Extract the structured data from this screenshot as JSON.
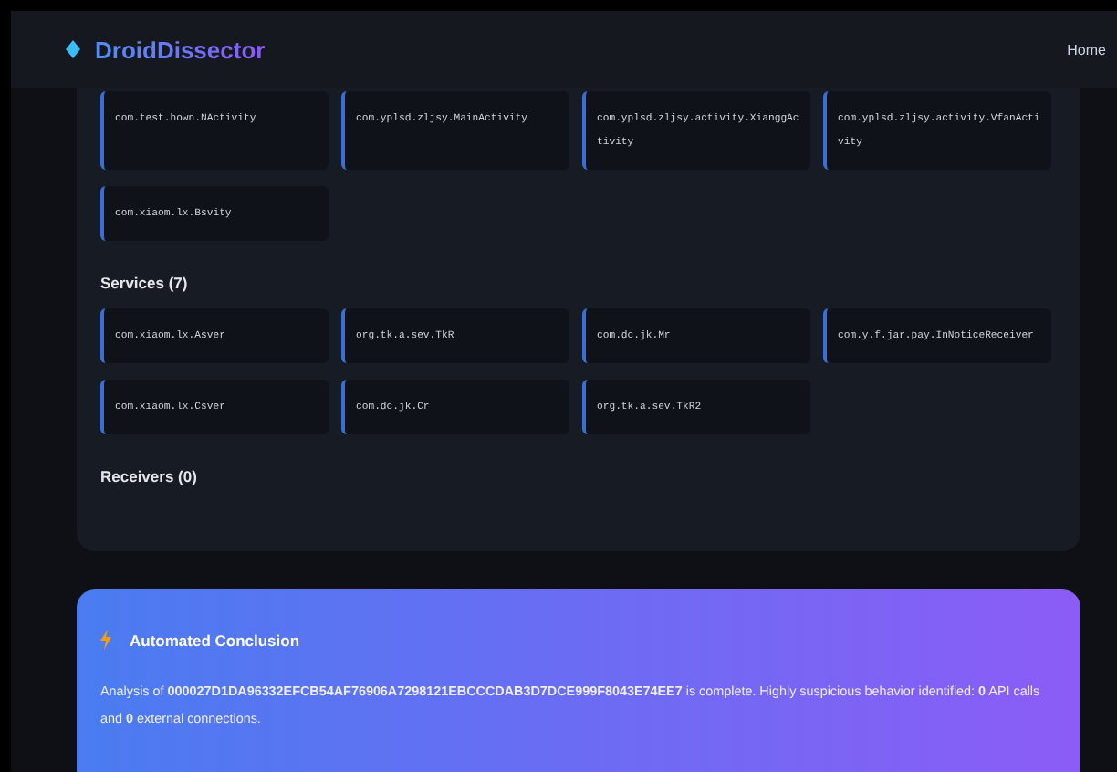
{
  "header": {
    "brand": "DroidDissector",
    "nav": [
      {
        "label": "Home"
      }
    ]
  },
  "sections": [
    {
      "items": [
        "com.test.hown.NActivity",
        "com.yplsd.zljsy.MainActivity",
        "com.yplsd.zljsy.activity.XianggActivity",
        "com.yplsd.zljsy.activity.VfanActivity",
        "com.xiaom.lx.Bsvity"
      ]
    },
    {
      "title": "Services (7)",
      "items": [
        "com.xiaom.lx.Asver",
        "org.tk.a.sev.TkR",
        "com.dc.jk.Mr",
        "com.y.f.jar.pay.InNoticeReceiver",
        "com.xiaom.lx.Csver",
        "com.dc.jk.Cr",
        "org.tk.a.sev.TkR2"
      ]
    },
    {
      "title": "Receivers (0)"
    }
  ],
  "conclusion": {
    "title": "Automated Conclusion",
    "text": "Analysis of **000027D1DA96332EFCB54AF76906A7298121EBCCCDAB3D7DCE999F8043E74EE7** is complete. Highly suspicious behavior identified: **0** API calls and **0** external connections."
  }
}
